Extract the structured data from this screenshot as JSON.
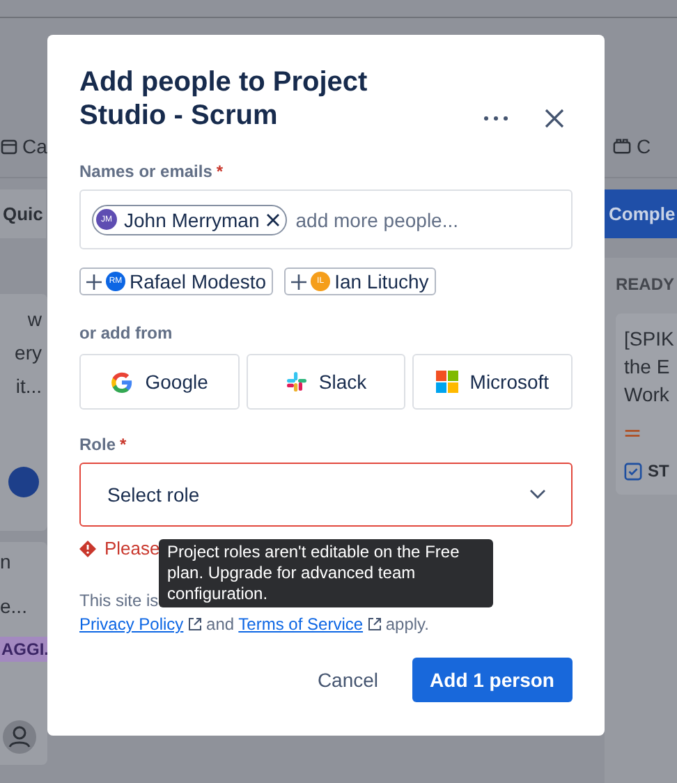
{
  "background": {
    "calendar_tab": "Ca",
    "right_tab": "C",
    "quick_filter": "Quic",
    "complete_button": "Comple",
    "column_header": "READY",
    "left_card": {
      "lines": [
        "w",
        "ery",
        "it..."
      ]
    },
    "left_card_2": {
      "lines": [
        "n",
        "e..."
      ],
      "tag": "AGGI."
    },
    "right_card": {
      "lines": [
        "[SPIK",
        "the E",
        "Work"
      ],
      "issue_key": "ST"
    }
  },
  "dialog": {
    "title": "Add people to Project Studio - Scrum",
    "names_label": "Names or emails",
    "required_mark": "*",
    "chips": [
      {
        "initials": "JM",
        "name": "John Merryman",
        "color": "#5e4db2"
      }
    ],
    "names_placeholder": "add more people...",
    "suggestions": [
      {
        "initials": "RM",
        "name": "Rafael Modesto",
        "color": "#0c66e4"
      },
      {
        "initials": "IL",
        "name": "Ian Lituchy",
        "color": "#f59e1b"
      }
    ],
    "add_from_label": "or add from",
    "providers": [
      {
        "kind": "google",
        "label": "Google"
      },
      {
        "kind": "slack",
        "label": "Slack"
      },
      {
        "kind": "microsoft",
        "label": "Microsoft"
      }
    ],
    "role_label": "Role",
    "role_required_mark": "*",
    "role_placeholder": "Select role",
    "role_invalid": true,
    "error": "Please",
    "tooltip": "Project roles aren't editable on the Free plan. Upgrade for advanced team configuration.",
    "legal": {
      "prefix": "This site is",
      "privacy_link": "Privacy Policy",
      "middle": "and",
      "terms_link": "Terms of Service",
      "suffix": "apply."
    },
    "buttons": {
      "cancel": "Cancel",
      "submit": "Add 1 person"
    }
  }
}
